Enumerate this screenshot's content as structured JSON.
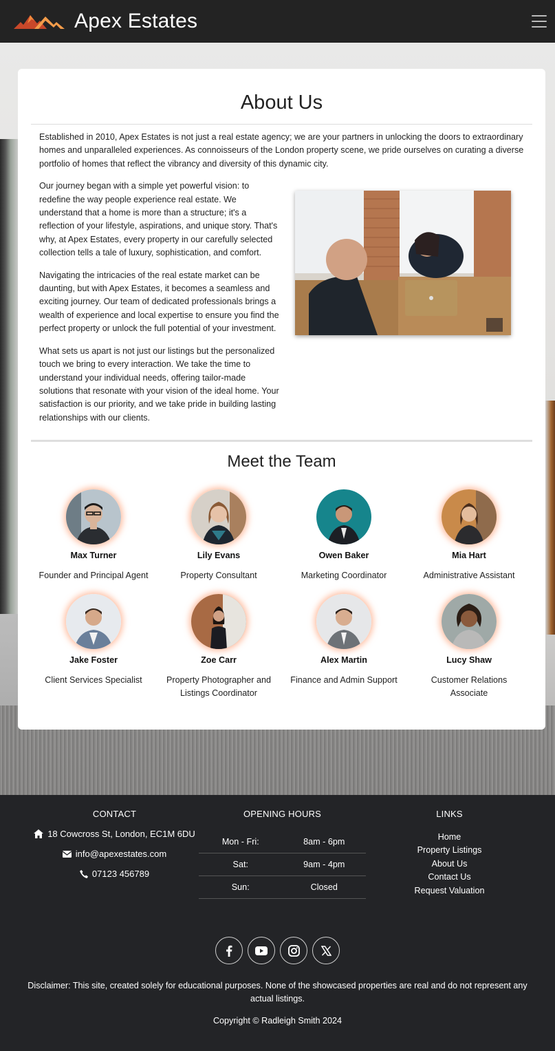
{
  "brand": {
    "name": "Apex Estates",
    "logo_icon": "mountain-logo-icon",
    "accent_color": "#e8682e"
  },
  "nav": {
    "menu_icon": "hamburger-menu-icon"
  },
  "about": {
    "title": "About Us",
    "intro": "Established in 2010, Apex Estates is not just a real estate agency; we are your partners in unlocking the doors to extraordinary homes and unparalleled experiences. As connoisseurs of the London property scene, we pride ourselves on curating a diverse portfolio of homes that reflect the vibrancy and diversity of this dynamic city.",
    "paragraphs": [
      "Our journey began with a simple yet powerful vision: to redefine the way people experience real estate. We understand that a home is more than a structure; it's a reflection of your lifestyle, aspirations, and unique story. That's why, at Apex Estates, every property in our carefully selected collection tells a tale of luxury, sophistication, and comfort.",
      "Navigating the intricacies of the real estate market can be daunting, but with Apex Estates, it becomes a seamless and exciting journey. Our team of dedicated professionals brings a wealth of experience and local expertise to ensure you find the perfect property or unlock the full potential of your investment.",
      "What sets us apart is not just our listings but the personalized touch we bring to every interaction. We take the time to understand your individual needs, offering tailor-made solutions that resonate with your vision of the ideal home. Your satisfaction is our priority, and we take pride in building lasting relationships with our clients."
    ]
  },
  "team": {
    "title": "Meet the Team",
    "members": [
      {
        "name": "Max Turner",
        "role": "Founder and Principal Agent"
      },
      {
        "name": "Lily Evans",
        "role": "Property Consultant"
      },
      {
        "name": "Owen Baker",
        "role": "Marketing Coordinator"
      },
      {
        "name": "Mia Hart",
        "role": "Administrative Assistant"
      },
      {
        "name": "Jake Foster",
        "role": "Client Services Specialist"
      },
      {
        "name": "Zoe Carr",
        "role": "Property Photographer and Listings Coordinator"
      },
      {
        "name": "Alex Martin",
        "role": "Finance and Admin Support"
      },
      {
        "name": "Lucy Shaw",
        "role": "Customer Relations Associate"
      }
    ]
  },
  "footer": {
    "contact": {
      "heading": "CONTACT",
      "address": "18 Cowcross St, London, EC1M 6DU",
      "email": "info@apexestates.com",
      "phone": "07123 456789"
    },
    "hours": {
      "heading": "OPENING HOURS",
      "rows": [
        {
          "day": "Mon - Fri:",
          "time": "8am - 6pm"
        },
        {
          "day": "Sat:",
          "time": "9am - 4pm"
        },
        {
          "day": "Sun:",
          "time": "Closed"
        }
      ]
    },
    "links": {
      "heading": "LINKS",
      "items": [
        "Home",
        "Property Listings",
        "About Us",
        "Contact Us",
        "Request Valuation"
      ]
    },
    "socials": [
      "facebook-icon",
      "youtube-icon",
      "instagram-icon",
      "x-icon"
    ],
    "disclaimer": "Disclaimer: This site, created solely for educational purposes. None of the showcased properties are real and do not represent any actual listings.",
    "copyright": "Copyright © Radleigh Smith 2024"
  }
}
